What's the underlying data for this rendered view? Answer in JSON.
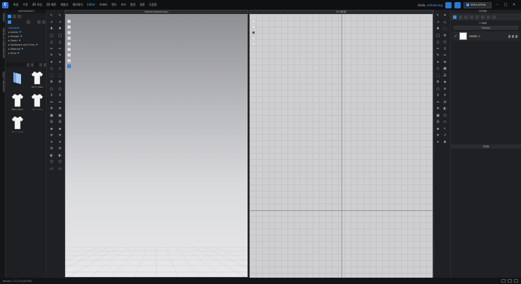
{
  "menu": {
    "items": [
      "파일",
      "수정",
      "3D 의상",
      "2D 패턴",
      "재봉선",
      "컬러와이",
      "Editor",
      "아바타",
      "렌더",
      "보기",
      "환경",
      "설정",
      "도움말"
    ],
    "active_index": 6,
    "user_label": "Hello,",
    "user_name": "mihaioning",
    "mode_label": "SIMULATION"
  },
  "vtabs": [
    "LIBRARY",
    "MODULAR CONFIGURATOR",
    "OBJECT BROWSER"
  ],
  "library": {
    "header": "AVATAR/ASSET",
    "tree": [
      {
        "label": "Garment",
        "root": true
      },
      {
        "label": "Avatar"
      },
      {
        "label": "Hanger"
      },
      {
        "label": "Fabric"
      },
      {
        "label": "Hardware and Trims"
      },
      {
        "label": "Material"
      },
      {
        "label": "Shoe"
      }
    ],
    "thumbs": [
      {
        "label": "",
        "kind": "folder"
      },
      {
        "label": "Tshirt_Wear",
        "kind": "tshirt"
      },
      {
        "label": "Male_Wear",
        "kind": "tshirt"
      },
      {
        "label": "Shirt_Wear",
        "kind": "tshirt",
        "dim": true
      },
      {
        "label": "Tshirt_Wear",
        "kind": "tshirt-small",
        "dim": true
      }
    ]
  },
  "viewport3d": {
    "title": "Default_Modelist.zprj"
  },
  "viewport2d": {
    "title": "2D 패턴창"
  },
  "right_panel": {
    "title": "오브젝트",
    "add_label": "+ Add",
    "filter_label": "Primary",
    "fabric_name": "FABRIC 1",
    "property_title": "속성창"
  },
  "status": {
    "version": "Version: 7.2.174 (r40728)"
  },
  "colors": {
    "accent": "#3a8ee6",
    "background": "#1b1b1d"
  }
}
